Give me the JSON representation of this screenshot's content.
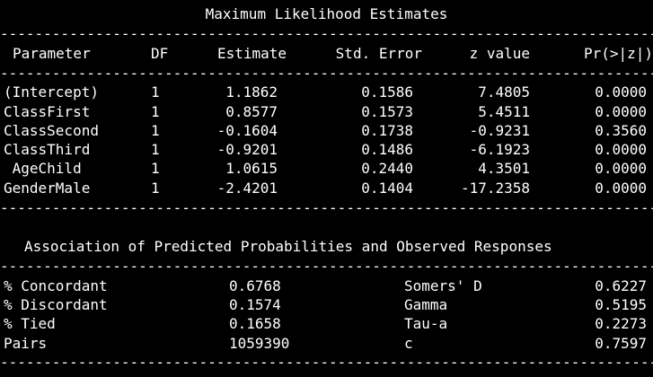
{
  "colors": {
    "background": "#000000",
    "text": "#ffffff"
  },
  "mle": {
    "title": "Maximum Likelihood Estimates",
    "rule": "------------------------------------------------------------------------------",
    "headers": [
      "Parameter",
      "DF",
      "Estimate",
      "Std. Error",
      "z value",
      "Pr(>|z|)"
    ],
    "rows": [
      {
        "param": "(Intercept)",
        "df": "1",
        "estimate": "1.1862",
        "se": "0.1586",
        "z": "7.4805",
        "p": "0.0000"
      },
      {
        "param": "ClassFirst",
        "df": "1",
        "estimate": "0.8577",
        "se": "0.1573",
        "z": "5.4511",
        "p": "0.0000"
      },
      {
        "param": "ClassSecond",
        "df": "1",
        "estimate": "-0.1604",
        "se": "0.1738",
        "z": "-0.9231",
        "p": "0.3560"
      },
      {
        "param": "ClassThird",
        "df": "1",
        "estimate": "-0.9201",
        "se": "0.1486",
        "z": "-6.1923",
        "p": "0.0000"
      },
      {
        "param": " AgeChild",
        "df": "1",
        "estimate": "1.0615",
        "se": "0.2440",
        "z": "4.3501",
        "p": "0.0000"
      },
      {
        "param": "GenderMale",
        "df": "1",
        "estimate": "-2.4201",
        "se": "0.1404",
        "z": "-17.2358",
        "p": "0.0000"
      }
    ]
  },
  "assoc": {
    "title": "Association of Predicted Probabilities and Observed Responses",
    "rows": [
      {
        "label": "% Concordant",
        "value": "0.6768",
        "label2": "Somers' D",
        "value2": "0.6227"
      },
      {
        "label": "% Discordant",
        "value": "0.1574",
        "label2": "Gamma",
        "value2": "0.5195"
      },
      {
        "label": "% Tied",
        "value": "0.1658",
        "label2": "Tau-a",
        "value2": "0.2273"
      },
      {
        "label": "Pairs",
        "value": "1059390",
        "label2": "c",
        "value2": "0.7597"
      }
    ]
  }
}
